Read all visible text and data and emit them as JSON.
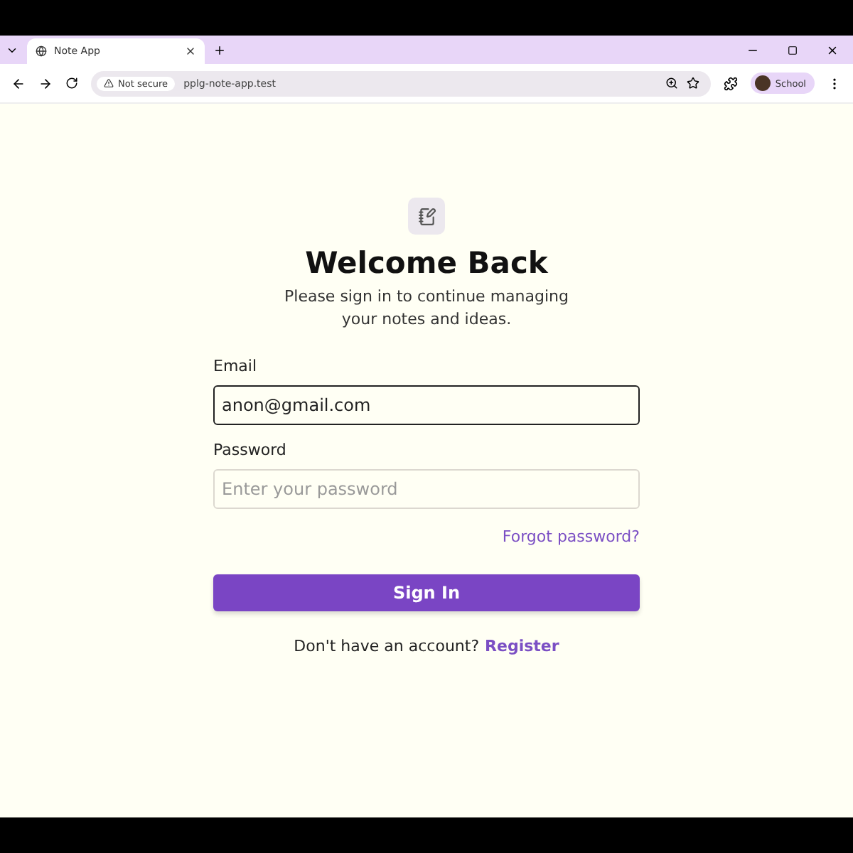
{
  "browser": {
    "tab_title": "Note App",
    "security_label": "Not secure",
    "url": "pplg-note-app.test",
    "profile_name": "School"
  },
  "login": {
    "title": "Welcome Back",
    "subtitle_lines": [
      "Please sign in to continue managing",
      "your notes and ideas."
    ],
    "fields": [
      {
        "label": "Email",
        "value": "anon@gmail.com",
        "focused": true
      },
      {
        "label": "Password",
        "placeholder": "Enter your password",
        "focused": false
      }
    ],
    "forgot_link": "Forgot password?",
    "submit_button": "Sign In",
    "register_prompt": "Don't have an account?",
    "register_link": "Register"
  }
}
